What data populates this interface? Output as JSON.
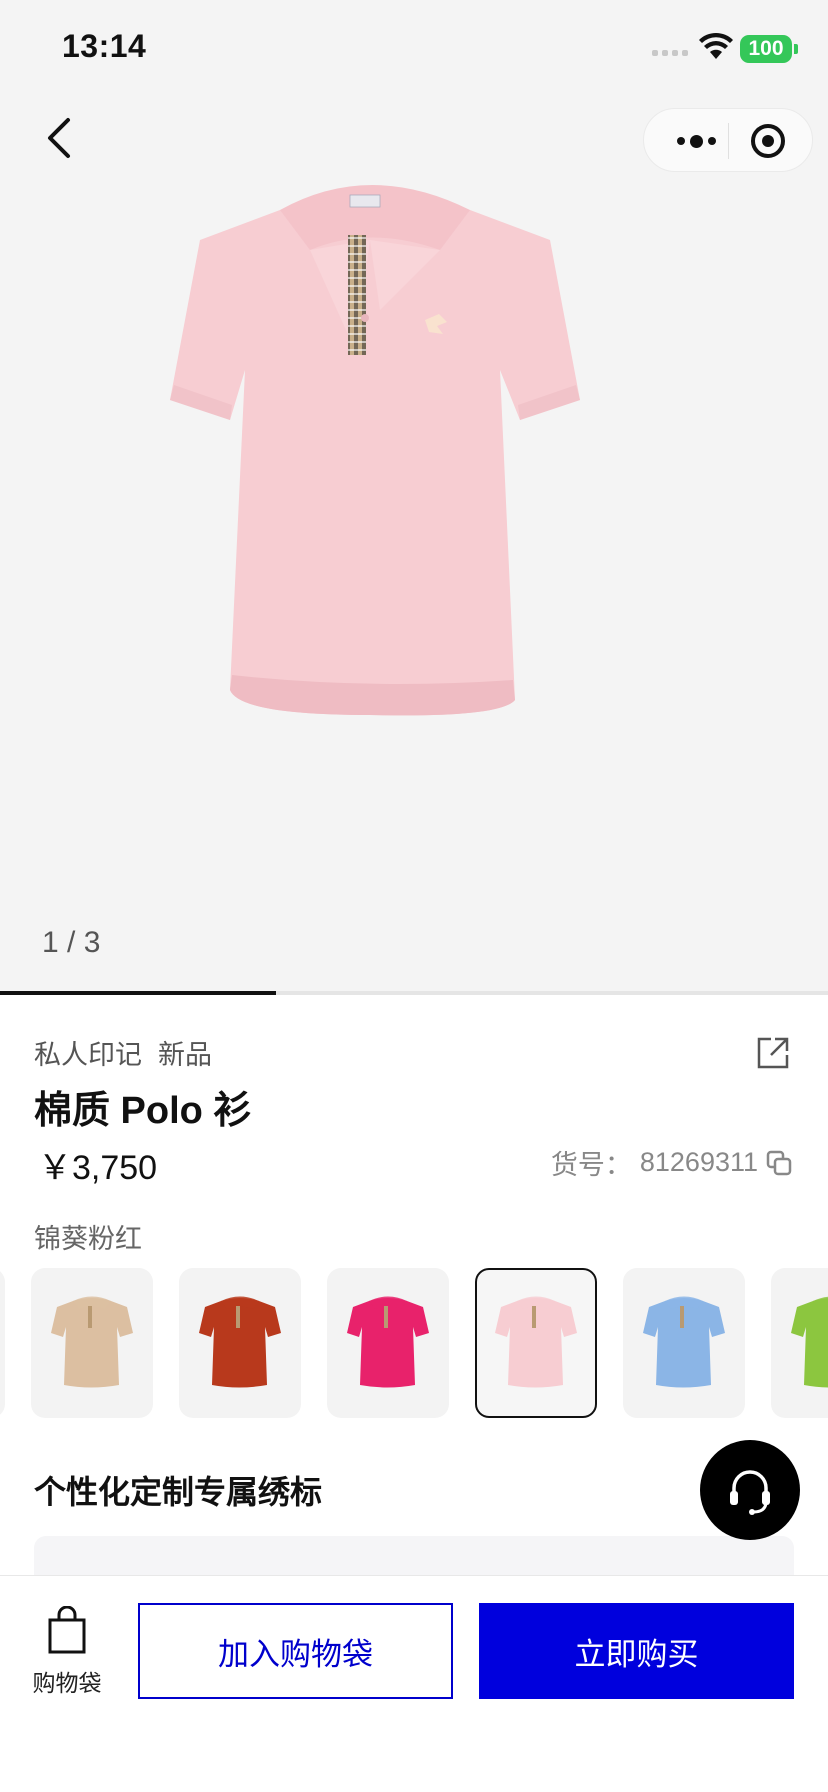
{
  "status_bar": {
    "time": "13:14",
    "battery": "100"
  },
  "nav": {
    "back_icon": "chevron-left-icon",
    "more_icon": "more-dots-icon",
    "close_icon": "target-close-icon"
  },
  "gallery": {
    "counter": "1 / 3",
    "current_index": 1,
    "total": 3,
    "progress_fraction": 0.333,
    "product_color": "#f7cdd2"
  },
  "product": {
    "tags": [
      "私人印记",
      "新品"
    ],
    "name": "棉质 Polo 衫",
    "price": "￥3,750",
    "sku_label": "货号：",
    "sku_value": "81269311",
    "color_name": "锦葵粉红"
  },
  "swatches": [
    {
      "color": "#dcbfa1",
      "selected": false
    },
    {
      "color": "#b8391c",
      "selected": false
    },
    {
      "color": "#e8226b",
      "selected": false
    },
    {
      "color": "#f7cdd2",
      "selected": true
    },
    {
      "color": "#8bb5e6",
      "selected": false
    },
    {
      "color": "#8cc63f",
      "selected": false
    }
  ],
  "customization": {
    "title": "个性化定制专属绣标"
  },
  "bottom_bar": {
    "bag_label": "购物袋",
    "add_to_cart": "加入购物袋",
    "buy_now": "立即购买"
  },
  "colors": {
    "accent": "#0000dd",
    "hero_bg": "#f4f4f4"
  }
}
